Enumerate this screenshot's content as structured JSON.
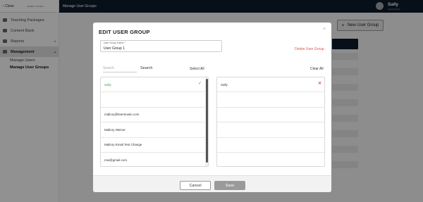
{
  "sidebar": {
    "close_label": "Close",
    "logo_text": "LEARN TO WIN",
    "items": [
      {
        "label": "Teaching Packages",
        "icon": "book-icon"
      },
      {
        "label": "Content Bank",
        "icon": "folder-icon"
      },
      {
        "label": "Reports",
        "icon": "chart-icon",
        "caret": "▾"
      },
      {
        "label": "Management",
        "icon": "users-icon",
        "caret": "▴"
      }
    ],
    "subitems": [
      {
        "label": "Manage Users"
      },
      {
        "label": "Manage User Groups"
      }
    ]
  },
  "topbar": {
    "title": "Manage User Groups",
    "user_name": "Sally",
    "user_sub": "Administrator"
  },
  "page": {
    "new_group_label": "New User Group",
    "plus": "+"
  },
  "modal": {
    "title": "EDIT USER GROUP",
    "close_glyph": "×",
    "field_label": "User Group Name *",
    "field_value": "User Group 1",
    "delete_label": "Delete User Group",
    "search_placeholder": "Search",
    "search_button": "Search",
    "select_all": "Select All",
    "clear_all": "Clear All",
    "left_list": [
      {
        "label": "Sally",
        "selected": true
      },
      {
        "label": ""
      },
      {
        "label": "mallory@learntowin.com"
      },
      {
        "label": "Mallory Weiner"
      },
      {
        "label": "Mallory Email Test Change"
      },
      {
        "label": "mw@gmail.com"
      }
    ],
    "right_list": [
      {
        "label": "Sally"
      }
    ],
    "cancel_label": "Cancel",
    "save_label": "Save"
  },
  "colors": {
    "topbar": "#0d1b2a",
    "selected_green": "#39a845",
    "delete_red": "#d9534f",
    "save_disabled": "#9a9a9a"
  }
}
